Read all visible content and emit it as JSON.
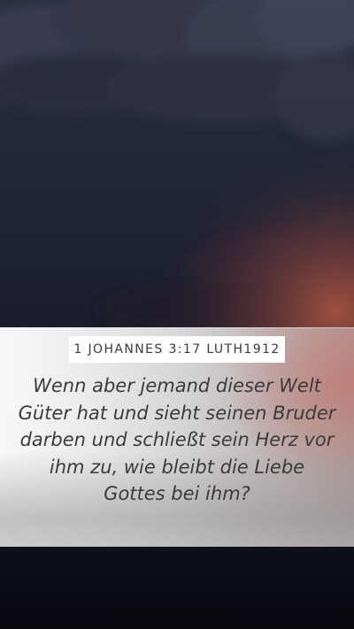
{
  "verse": {
    "reference": "1 JOHANNES 3:17 LUTH1912",
    "text": "Wenn aber jemand dieser Welt Güter hat und sieht seinen Bruder darben und schließt sein Herz vor ihm zu, wie bleibt die Liebe Gottes bei ihm?"
  },
  "colors": {
    "sky_top": "#2c3142",
    "sky_bottom": "#07080f",
    "sunset_glow": "#c4766c",
    "text": "#3b3b3b"
  }
}
